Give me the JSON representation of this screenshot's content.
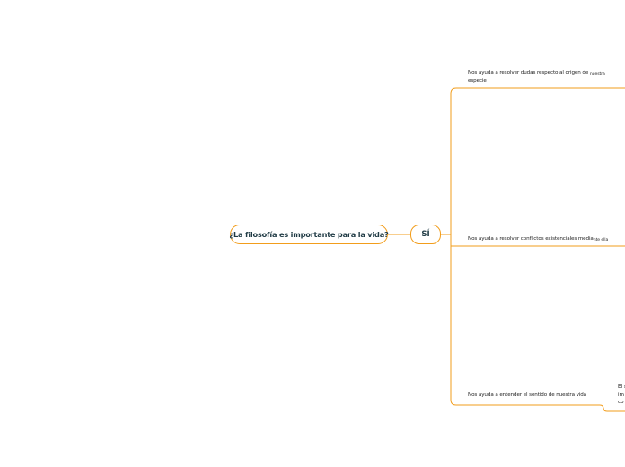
{
  "central_topic": "¿La filosofía es importante para la vida?",
  "main_topic": "SÍ",
  "subtopics": [
    {
      "line1": "Nos ayuda a resolver dudas respecto al origen de ",
      "line1_tail": "nuestra",
      "line2": "especie"
    },
    {
      "line1": "Nos ayuda a resolver conflictos existenciales media",
      "line1_tail": "nte ella"
    },
    {
      "line1": "Nos ayuda a entender el sentido de nuestra vida"
    }
  ],
  "partial_note": {
    "lines": [
      "El s",
      "im",
      "co"
    ]
  },
  "colors": {
    "branch": "#f29d1b",
    "text": "#1f3a44"
  }
}
